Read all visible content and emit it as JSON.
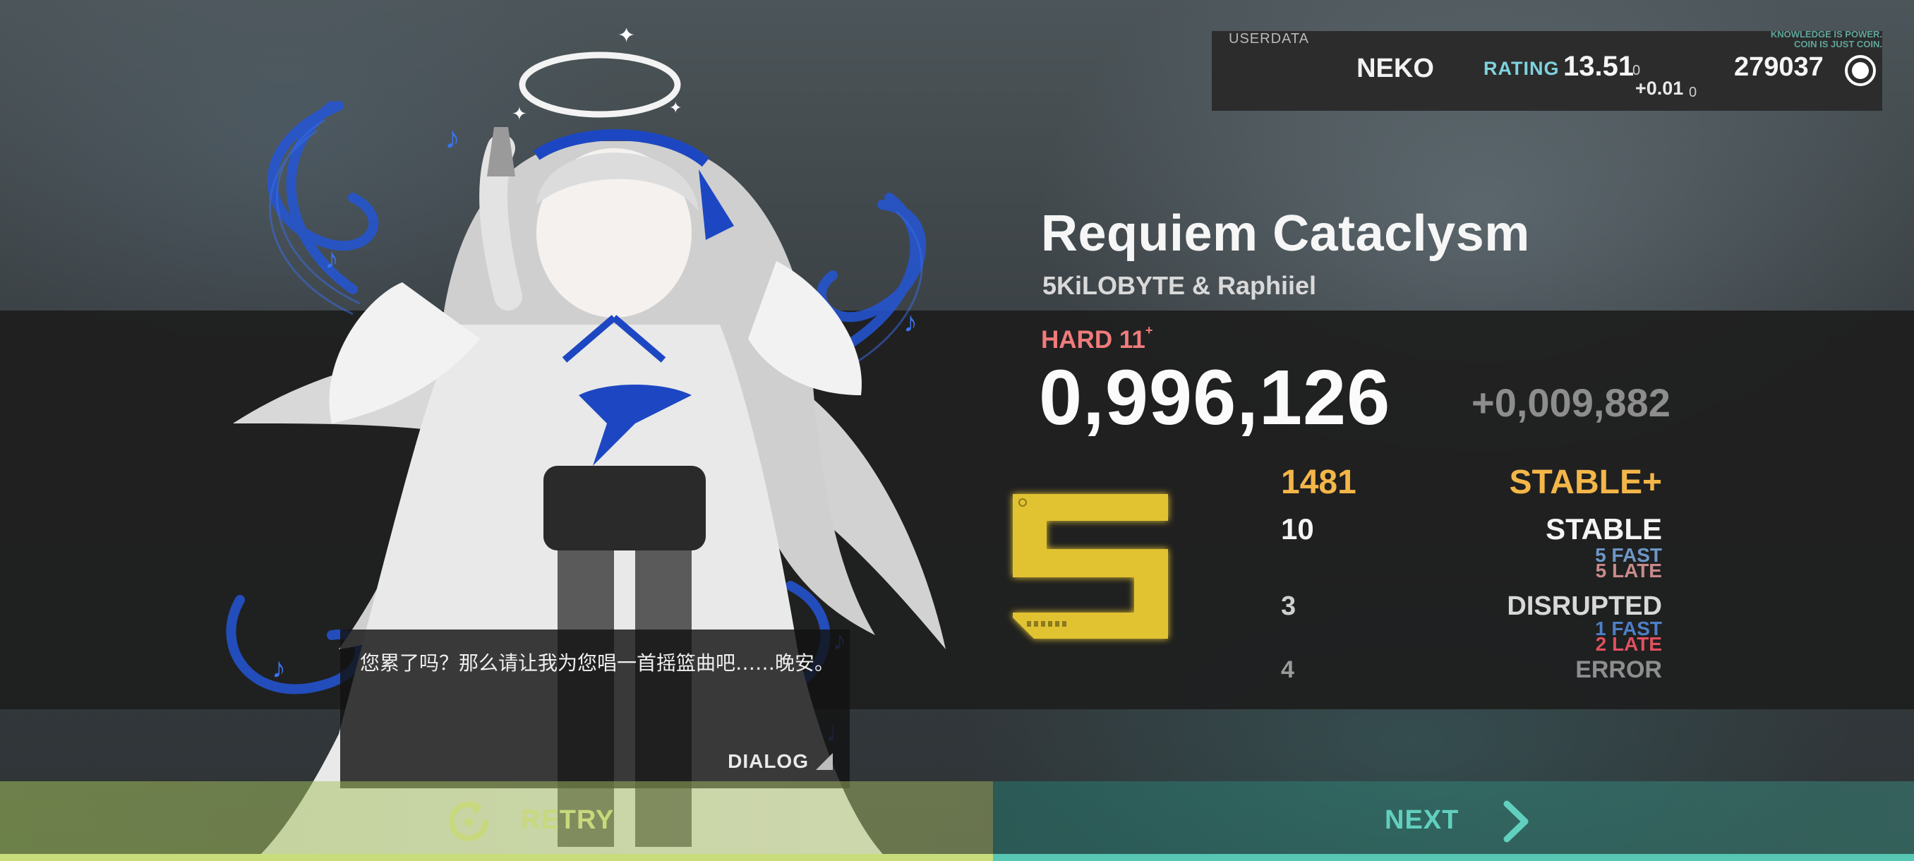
{
  "userdata": {
    "label": "USERDATA",
    "name": "NEKO",
    "rating_label": "RATING",
    "rating": "13.51",
    "rating_sub": "0",
    "rating_delta": "+0.01",
    "rating_delta_sub": "0",
    "coins": "279037",
    "coin_icon": "coin-icon",
    "motto_line1": "KNOWLEDGE IS POWER.",
    "motto_line2": "COIN IS JUST COIN."
  },
  "song": {
    "title": "Requiem Cataclysm",
    "artist": "5KiLOBYTE & Raphiiel",
    "difficulty": "HARD 11",
    "difficulty_plus": "+"
  },
  "result": {
    "score": "0,996,126",
    "score_delta": "+0,009,882",
    "grade": "S",
    "judgements": {
      "stable_plus": {
        "count": "1481",
        "label": "STABLE+"
      },
      "stable": {
        "count": "10",
        "label": "STABLE",
        "fast": "5 FAST",
        "late": "5 LATE"
      },
      "disrupted": {
        "count": "3",
        "label": "DISRUPTED",
        "fast": "1 FAST",
        "late": "2 LATE"
      },
      "error": {
        "count": "4",
        "label": "ERROR"
      }
    }
  },
  "dialog": {
    "text": "您累了吗？那么请让我为您唱一首摇篮曲吧……晚安。",
    "button": "DIALOG"
  },
  "buttons": {
    "retry": "RETRY",
    "next": "NEXT"
  },
  "colors": {
    "accent_rating": "#7fd3de",
    "difficulty_hard": "#f07b7b",
    "stable_plus": "#f4b648",
    "fast": "#6e97c7",
    "late_stable": "#c98a8a",
    "late_disrupted": "#e0505e",
    "grade": "#e1c330",
    "retry": "#c9dc7c",
    "next": "#55c7b2"
  }
}
